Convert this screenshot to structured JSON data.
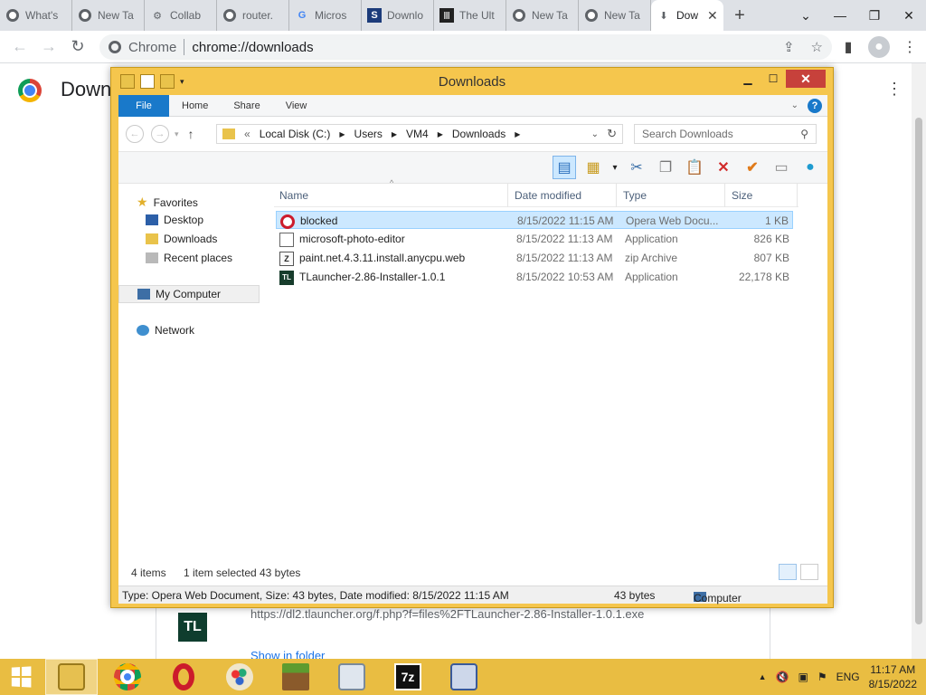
{
  "chrome": {
    "tabs": [
      {
        "title": "What's",
        "icon": "chrome-icon"
      },
      {
        "title": "New Ta",
        "icon": "chrome-icon"
      },
      {
        "title": "Collab",
        "icon": "github-icon"
      },
      {
        "title": "router.",
        "icon": "globe-icon"
      },
      {
        "title": "Micros",
        "icon": "google-icon"
      },
      {
        "title": "Downlo",
        "icon": "softonic-icon"
      },
      {
        "title": "The Ult",
        "icon": "museum-icon"
      },
      {
        "title": "New Ta",
        "icon": "chrome-icon"
      },
      {
        "title": "New Ta",
        "icon": "chrome-icon"
      },
      {
        "title": "Dow",
        "icon": "download-icon",
        "active": true
      }
    ],
    "new_tab": "+",
    "window_controls": {
      "minimize": "⌄",
      "restore": "❐",
      "close": "✕"
    },
    "omnibox": {
      "label": "Chrome",
      "url": "chrome://downloads"
    },
    "page_title": "Down",
    "download_card": {
      "icon_text": "TL",
      "url": "https://dl2.tlauncher.org/f.php?f=files%2FTLauncher-2.86-Installer-1.0.1.exe",
      "show_in_folder": "Show in folder"
    }
  },
  "explorer": {
    "title": "Downloads",
    "ribbon": {
      "file": "File",
      "tabs": [
        "Home",
        "Share",
        "View"
      ]
    },
    "address": {
      "prefix": "«",
      "crumbs": [
        "Local Disk (C:)",
        "Users",
        "VM4",
        "Downloads"
      ]
    },
    "search_placeholder": "Search Downloads",
    "nav": {
      "favorites": "Favorites",
      "desktop": "Desktop",
      "downloads": "Downloads",
      "recent": "Recent places",
      "computer": "My Computer",
      "network": "Network"
    },
    "columns": {
      "name": "Name",
      "date": "Date modified",
      "type": "Type",
      "size": "Size"
    },
    "files": [
      {
        "name": "blocked",
        "date": "8/15/2022 11:15 AM",
        "type": "Opera Web Docu...",
        "size": "1 KB",
        "icon": "opera-icon",
        "selected": true
      },
      {
        "name": "microsoft-photo-editor",
        "date": "8/15/2022 11:13 AM",
        "type": "Application",
        "size": "826 KB",
        "icon": "application-icon"
      },
      {
        "name": "paint.net.4.3.11.install.anycpu.web",
        "date": "8/15/2022 11:13 AM",
        "type": "zip Archive",
        "size": "807 KB",
        "icon": "zip-icon"
      },
      {
        "name": "TLauncher-2.86-Installer-1.0.1",
        "date": "8/15/2022 10:53 AM",
        "type": "Application",
        "size": "22,178 KB",
        "icon": "tlauncher-icon"
      }
    ],
    "status": {
      "count": "4 items",
      "selected": "1 item selected",
      "bytes": "43 bytes"
    },
    "details": {
      "summary": "Type: Opera Web Document, Size: 43 bytes, Date modified: 8/15/2022 11:15 AM",
      "size": "43 bytes",
      "location": "Computer"
    }
  },
  "taskbar": {
    "items": [
      "explorer-icon",
      "chrome-icon",
      "opera-icon",
      "paint-icon",
      "minecraft-icon",
      "monitor-icon",
      "7zip-icon",
      "network-tool-icon"
    ],
    "sevenzip_label": "7z",
    "language": "ENG",
    "time": "11:17 AM",
    "date": "8/15/2022"
  },
  "colors": {
    "taskbar": "#e9bd42",
    "explorer_frame": "#f5c64d",
    "selection": "#cce8ff",
    "file_tab": "#1979ca",
    "close_button": "#c7413b"
  }
}
